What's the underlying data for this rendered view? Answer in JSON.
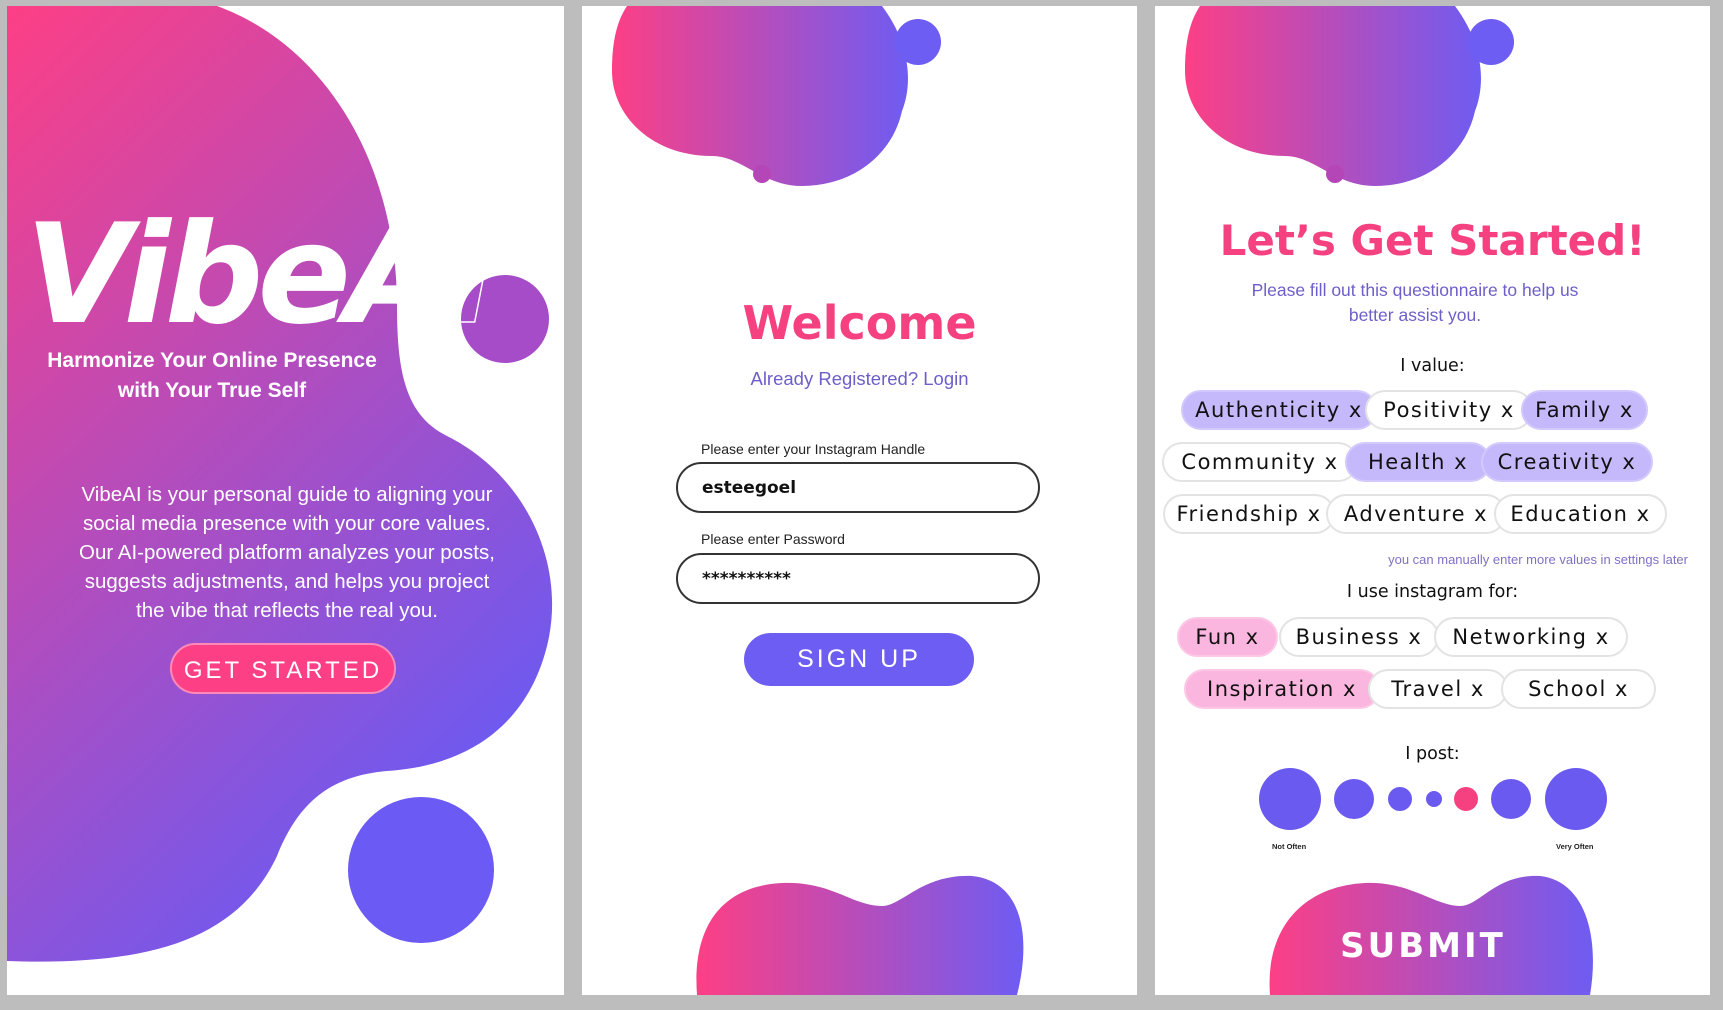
{
  "splash": {
    "logo_solid": "VibeA",
    "logo_outline": "I",
    "tagline": "Harmonize Your Online Presence with Your True Self",
    "description": "VibeAI is your personal guide to aligning your social media presence with your core values. Our AI-powered platform analyzes your posts, suggests adjustments, and helps you project the vibe that reflects the real you.",
    "cta_label": "GET STARTED"
  },
  "signup": {
    "title": "Welcome",
    "login_link": "Already Registered? Login",
    "handle_label": "Please enter your Instagram Handle",
    "handle_value": "esteegoel",
    "password_label": "Please enter Password",
    "password_value": "**********",
    "submit_label": "SIGN UP"
  },
  "questionnaire": {
    "title": "Let’s Get Started!",
    "subtitle": "Please fill out this questionnaire to help us better assist you.",
    "values_label": "I value:",
    "values": [
      {
        "label": "Authenticity x",
        "selected": true
      },
      {
        "label": "Positivity x",
        "selected": false
      },
      {
        "label": "Family x",
        "selected": true
      },
      {
        "label": "Community x",
        "selected": false
      },
      {
        "label": "Health x",
        "selected": true
      },
      {
        "label": "Creativity x",
        "selected": true
      },
      {
        "label": "Friendship x",
        "selected": false
      },
      {
        "label": "Adventure x",
        "selected": false
      },
      {
        "label": "Education x",
        "selected": false
      }
    ],
    "values_hint": "you can manually enter more values in settings later",
    "usage_label": "I use instagram for:",
    "usage": [
      {
        "label": "Fun x",
        "selected": true
      },
      {
        "label": "Business x",
        "selected": false
      },
      {
        "label": "Networking x",
        "selected": false
      },
      {
        "label": "Inspiration x",
        "selected": true
      },
      {
        "label": "Travel x",
        "selected": false
      },
      {
        "label": "School x",
        "selected": false
      }
    ],
    "frequency_label": "I post:",
    "frequency_min_label": "Not Often",
    "frequency_max_label": "Very Often",
    "frequency_selected": 5,
    "frequency_steps": 7,
    "submit_label": "SUBMIT"
  },
  "colors": {
    "pink": "#fd3f85",
    "purple": "#6d5df2",
    "title_pink": "#f5417f",
    "link_purple": "#6d5fc9"
  }
}
